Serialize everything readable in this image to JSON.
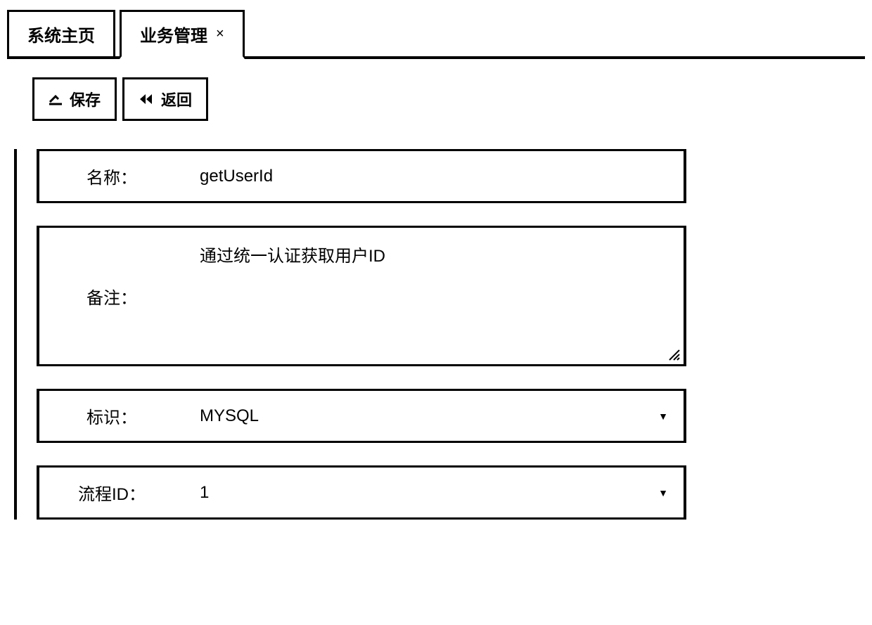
{
  "tabs": {
    "home": "系统主页",
    "active": "业务管理",
    "close_symbol": "×"
  },
  "toolbar": {
    "save_label": "保存",
    "back_label": "返回"
  },
  "form": {
    "name": {
      "label": "名称：",
      "value": "getUserId"
    },
    "remark": {
      "label": "备注：",
      "value": "通过统一认证获取用户ID"
    },
    "identifier": {
      "label": "标识：",
      "value": "MYSQL"
    },
    "process_id": {
      "label": "流程ID：",
      "value": "1"
    }
  }
}
